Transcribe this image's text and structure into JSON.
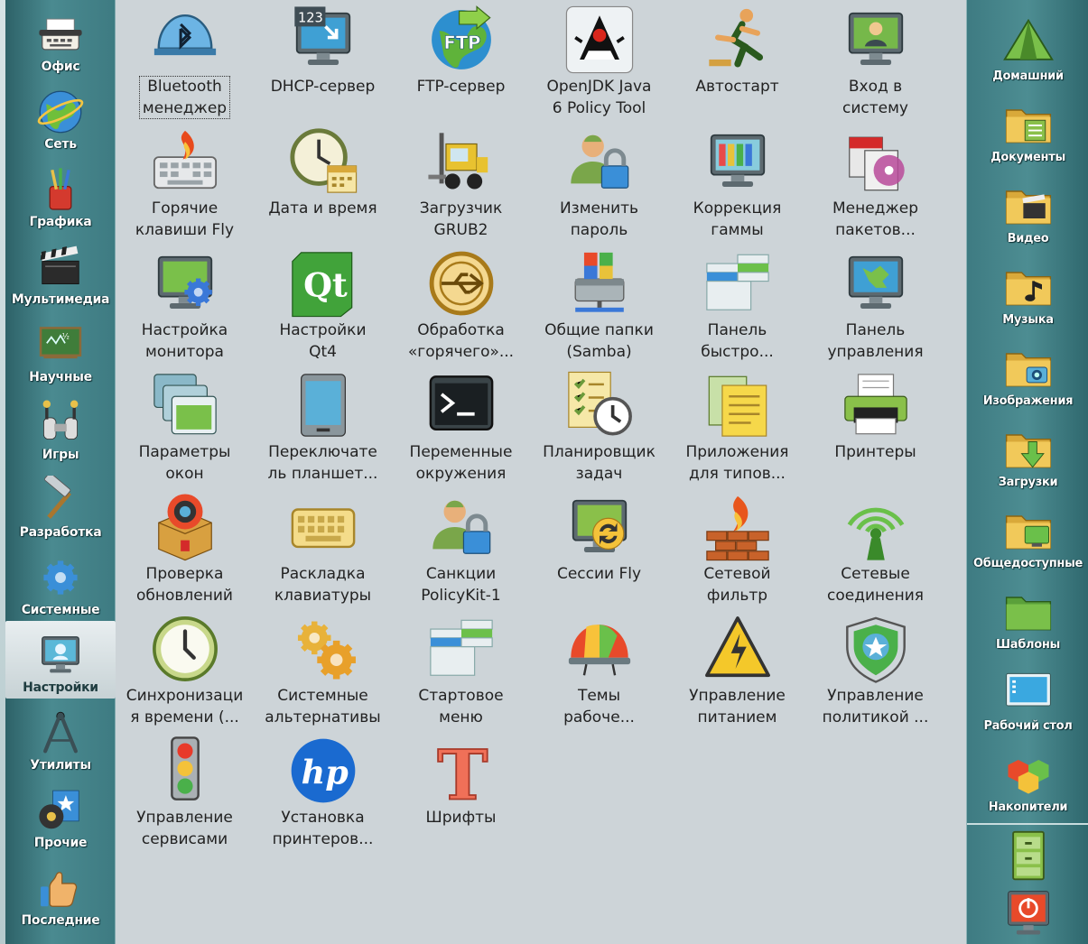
{
  "left_sidebar": {
    "categories": [
      {
        "label": "Офис",
        "icon": "typewriter-icon",
        "active": false
      },
      {
        "label": "Сеть",
        "icon": "globe-icon",
        "active": false
      },
      {
        "label": "Графика",
        "icon": "brushes-cup-icon",
        "active": false
      },
      {
        "label": "Мультимедиа",
        "icon": "clapperboard-icon",
        "active": false
      },
      {
        "label": "Научные",
        "icon": "chalkboard-icon",
        "active": false
      },
      {
        "label": "Игры",
        "icon": "gamepad-icon",
        "active": false
      },
      {
        "label": "Разработка",
        "icon": "hammer-icon",
        "active": false
      },
      {
        "label": "Системные",
        "icon": "gear-icon",
        "active": false
      },
      {
        "label": "Настройки",
        "icon": "monitor-settings-icon",
        "active": true
      },
      {
        "label": "Утилиты",
        "icon": "compass-icon",
        "active": false
      },
      {
        "label": "Прочие",
        "icon": "disc-star-icon",
        "active": false
      },
      {
        "label": "Последние",
        "icon": "thumbs-up-icon",
        "active": false
      }
    ]
  },
  "apps": [
    {
      "label": "Bluetooth\nменеджер",
      "icon": "bluetooth-helmet-icon",
      "focused": true
    },
    {
      "label": "DHCP-сервер",
      "icon": "dhcp-monitor-icon"
    },
    {
      "label": "FTP-сервер",
      "icon": "ftp-globe-icon"
    },
    {
      "label": "OpenJDK Java\n6 Policy Tool",
      "icon": "java-duke-icon"
    },
    {
      "label": "Автостарт",
      "icon": "runner-icon"
    },
    {
      "label": "Вход в\nсистему",
      "icon": "login-monitor-icon"
    },
    {
      "label": "Горячие\nклавиши Fly",
      "icon": "hotkeys-keyboard-icon"
    },
    {
      "label": "Дата и время",
      "icon": "clock-calendar-icon"
    },
    {
      "label": "Загрузчик\nGRUB2",
      "icon": "forklift-icon"
    },
    {
      "label": "Изменить\nпароль",
      "icon": "user-lock-icon"
    },
    {
      "label": "Коррекция\nгаммы",
      "icon": "gamma-monitor-icon"
    },
    {
      "label": "Менеджер\nпакетов...",
      "icon": "package-manager-icon"
    },
    {
      "label": "Настройка\nмонитора",
      "icon": "monitor-gear-icon"
    },
    {
      "label": "Настройки\nQt4",
      "icon": "qt-logo-icon"
    },
    {
      "label": "Обработка\n«горячего»...",
      "icon": "usb-circle-icon"
    },
    {
      "label": "Общие папки\n(Samba)",
      "icon": "samba-share-icon"
    },
    {
      "label": "Панель\nбыстро...",
      "icon": "quick-panel-icon"
    },
    {
      "label": "Панель\nуправления",
      "icon": "control-panel-monitor-icon"
    },
    {
      "label": "Параметры\nокон",
      "icon": "windows-stack-icon"
    },
    {
      "label": "Переключате\nль планшет...",
      "icon": "tablet-icon"
    },
    {
      "label": "Переменные\nокружения",
      "icon": "terminal-icon"
    },
    {
      "label": "Планировщик\nзадач",
      "icon": "task-scheduler-icon"
    },
    {
      "label": "Приложения\nдля типов...",
      "icon": "document-types-icon"
    },
    {
      "label": "Принтеры",
      "icon": "printer-icon"
    },
    {
      "label": "Проверка\nобновлений",
      "icon": "update-box-icon"
    },
    {
      "label": "Раскладка\nклавиатуры",
      "icon": "keyboard-icon"
    },
    {
      "label": "Санкции\nPolicyKit-1",
      "icon": "policykit-user-lock-icon"
    },
    {
      "label": "Сессии Fly",
      "icon": "sessions-monitor-icon"
    },
    {
      "label": "Сетевой\nфильтр",
      "icon": "firewall-icon"
    },
    {
      "label": "Сетевые\nсоединения",
      "icon": "wireless-antenna-icon"
    },
    {
      "label": "Синхронизаци\nя времени (...",
      "icon": "clock-icon"
    },
    {
      "label": "Системные\nальтернативы",
      "icon": "gears-icon"
    },
    {
      "label": "Стартовое\nменю",
      "icon": "start-menu-icon"
    },
    {
      "label": "Темы\nрабоче...",
      "icon": "themes-helmet-icon"
    },
    {
      "label": "Управление\nпитанием",
      "icon": "power-warning-icon"
    },
    {
      "label": "Управление\nполитикой ...",
      "icon": "policy-shield-icon"
    },
    {
      "label": "Управление\nсервисами",
      "icon": "traffic-light-icon"
    },
    {
      "label": "Установка\nпринтеров...",
      "icon": "hp-logo-icon"
    },
    {
      "label": "Шрифты",
      "icon": "font-t-icon"
    }
  ],
  "right_sidebar": {
    "places": [
      {
        "label": "Домашний",
        "icon": "home-tent-icon"
      },
      {
        "label": "Документы",
        "icon": "documents-folder-icon"
      },
      {
        "label": "Видео",
        "icon": "video-folder-icon"
      },
      {
        "label": "Музыка",
        "icon": "music-folder-icon"
      },
      {
        "label": "Изображения",
        "icon": "images-folder-icon"
      },
      {
        "label": "Загрузки",
        "icon": "downloads-folder-icon"
      },
      {
        "label": "Общедоступные",
        "icon": "public-folder-icon"
      },
      {
        "label": "Шаблоны",
        "icon": "templates-folder-icon"
      },
      {
        "label": "Рабочий стол",
        "icon": "desktop-icon"
      },
      {
        "label": "Накопители",
        "icon": "drives-cubes-icon"
      }
    ],
    "system_buttons": [
      {
        "icon": "filing-cabinet-icon"
      },
      {
        "icon": "shutdown-icon"
      }
    ]
  }
}
